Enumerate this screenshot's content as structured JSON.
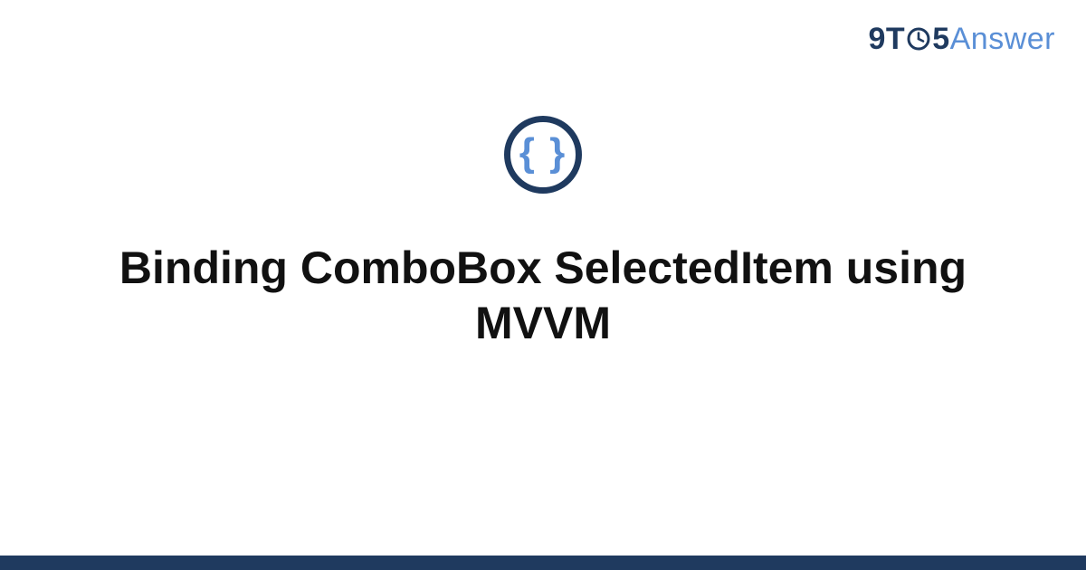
{
  "brand": {
    "part1": "9T",
    "part2": "5",
    "part3": "Answer"
  },
  "badge": {
    "glyph": "{ }"
  },
  "title": "Binding ComboBox SelectedItem using MVVM",
  "colors": {
    "dark": "#1f3a5f",
    "light": "#5a8fd6"
  }
}
